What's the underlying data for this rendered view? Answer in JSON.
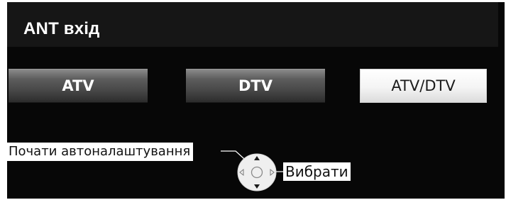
{
  "header": {
    "title": "ANT вхід"
  },
  "options": [
    {
      "label": "ATV",
      "selected": false
    },
    {
      "label": "DTV",
      "selected": false
    },
    {
      "label": "ATV/DTV",
      "selected": true
    }
  ],
  "hints": {
    "start": "Почати автоналаштування",
    "select": "Вибрати"
  },
  "icons": {
    "dpad": "dpad-icon",
    "ok": "ok-circle-icon",
    "up": "arrow-up-icon",
    "down": "arrow-down-icon",
    "left": "arrow-left-icon",
    "right": "arrow-right-icon"
  },
  "colors": {
    "screen_bg": "#070707",
    "header_bg": "#161616",
    "selected_bg": "#ffffff",
    "unselected_bg": "#505050"
  }
}
